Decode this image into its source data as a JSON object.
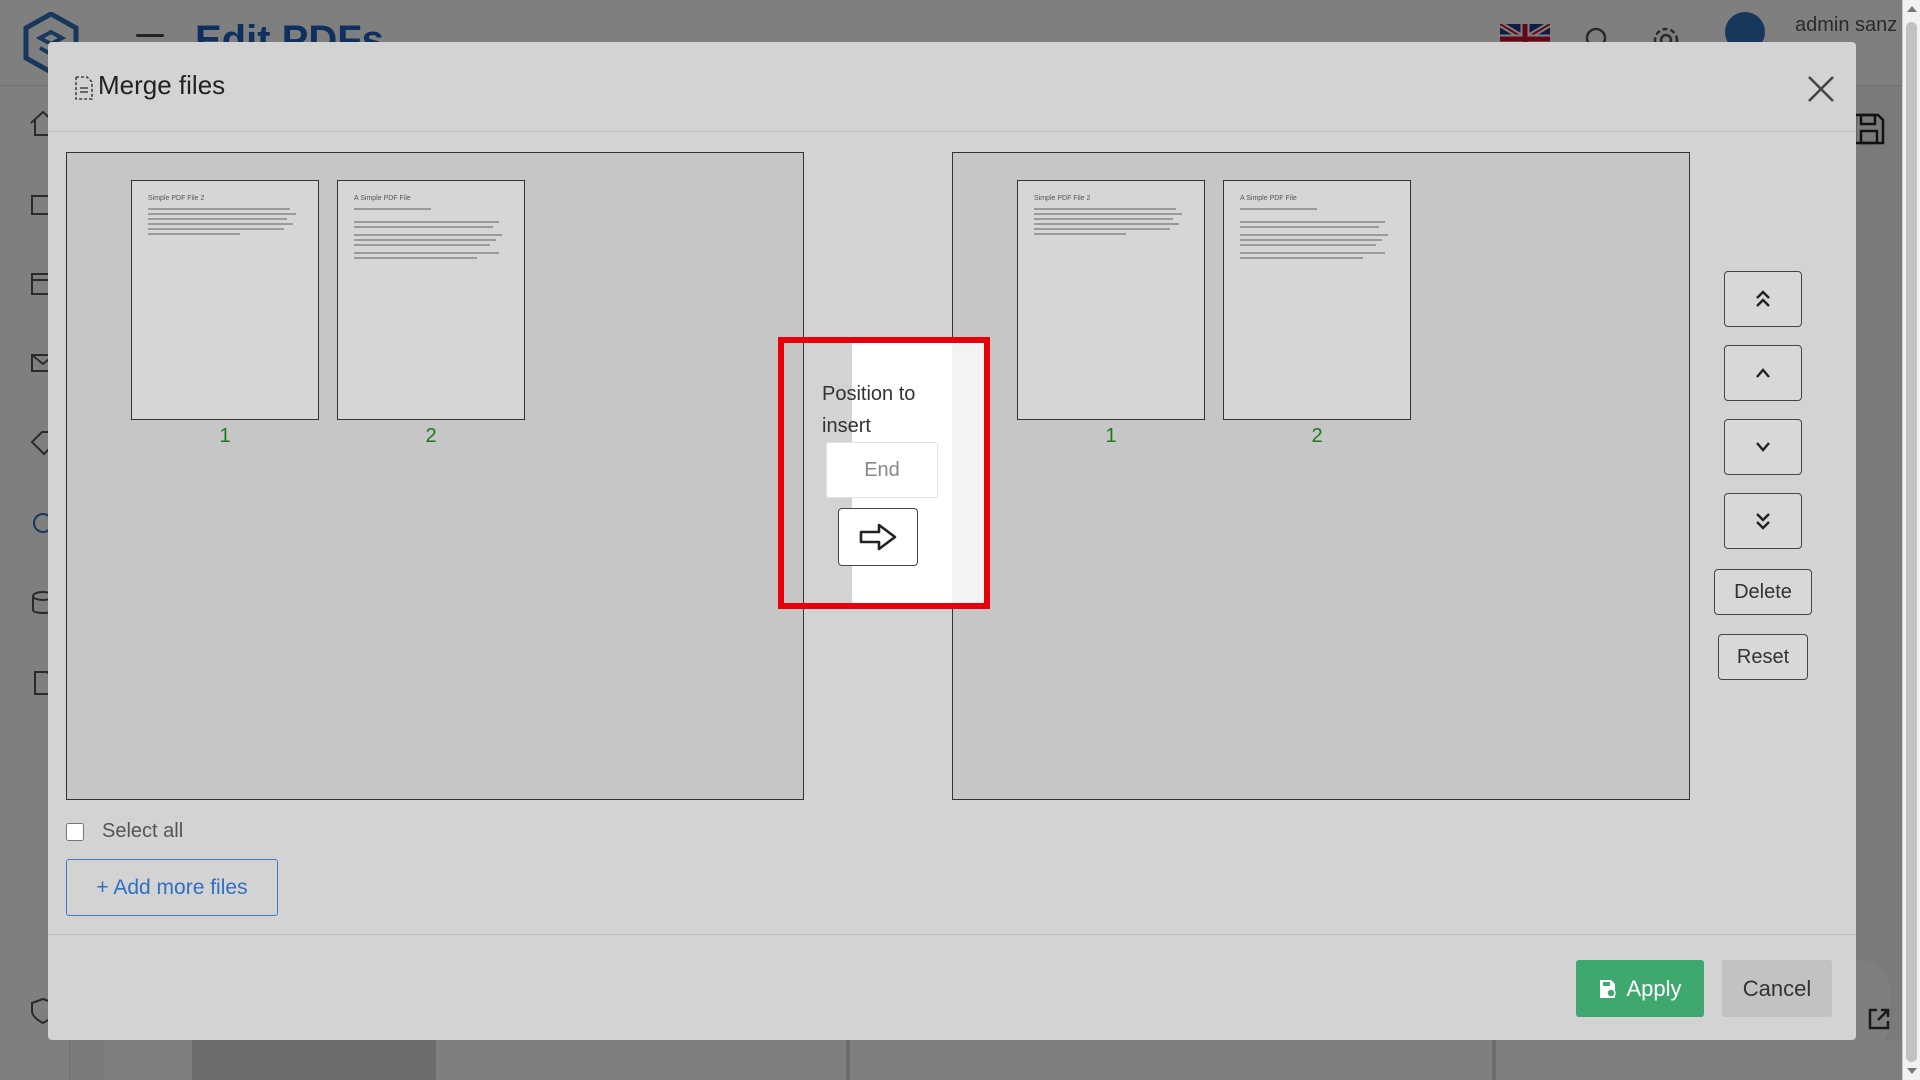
{
  "app": {
    "title": "Edit PDFs",
    "user_name": "admin sanz"
  },
  "modal": {
    "title": "Merge files",
    "left_pane": {
      "pages": [
        {
          "number": "1",
          "heading": "Simple PDF File 2"
        },
        {
          "number": "2",
          "heading": "A Simple PDF File"
        }
      ]
    },
    "right_pane": {
      "pages": [
        {
          "number": "1",
          "heading": "Simple PDF File 2"
        },
        {
          "number": "2",
          "heading": "A Simple PDF File"
        }
      ]
    },
    "insert": {
      "label": "Position to insert",
      "placeholder": "End"
    },
    "controls": {
      "delete_label": "Delete",
      "reset_label": "Reset"
    },
    "select_all_label": "Select all",
    "add_more_label": "+ Add more files",
    "apply_label": "Apply",
    "cancel_label": "Cancel"
  },
  "colors": {
    "highlight": "#e8000b",
    "apply": "#3fa86f",
    "page_number": "#1a7a1a",
    "link": "#2f6fc4"
  },
  "icons": [
    "doc-icon",
    "close-icon",
    "arrow-right-icon",
    "double-chevron-up-icon",
    "chevron-up-icon",
    "chevron-down-icon",
    "double-chevron-down-icon",
    "save-file-icon"
  ]
}
